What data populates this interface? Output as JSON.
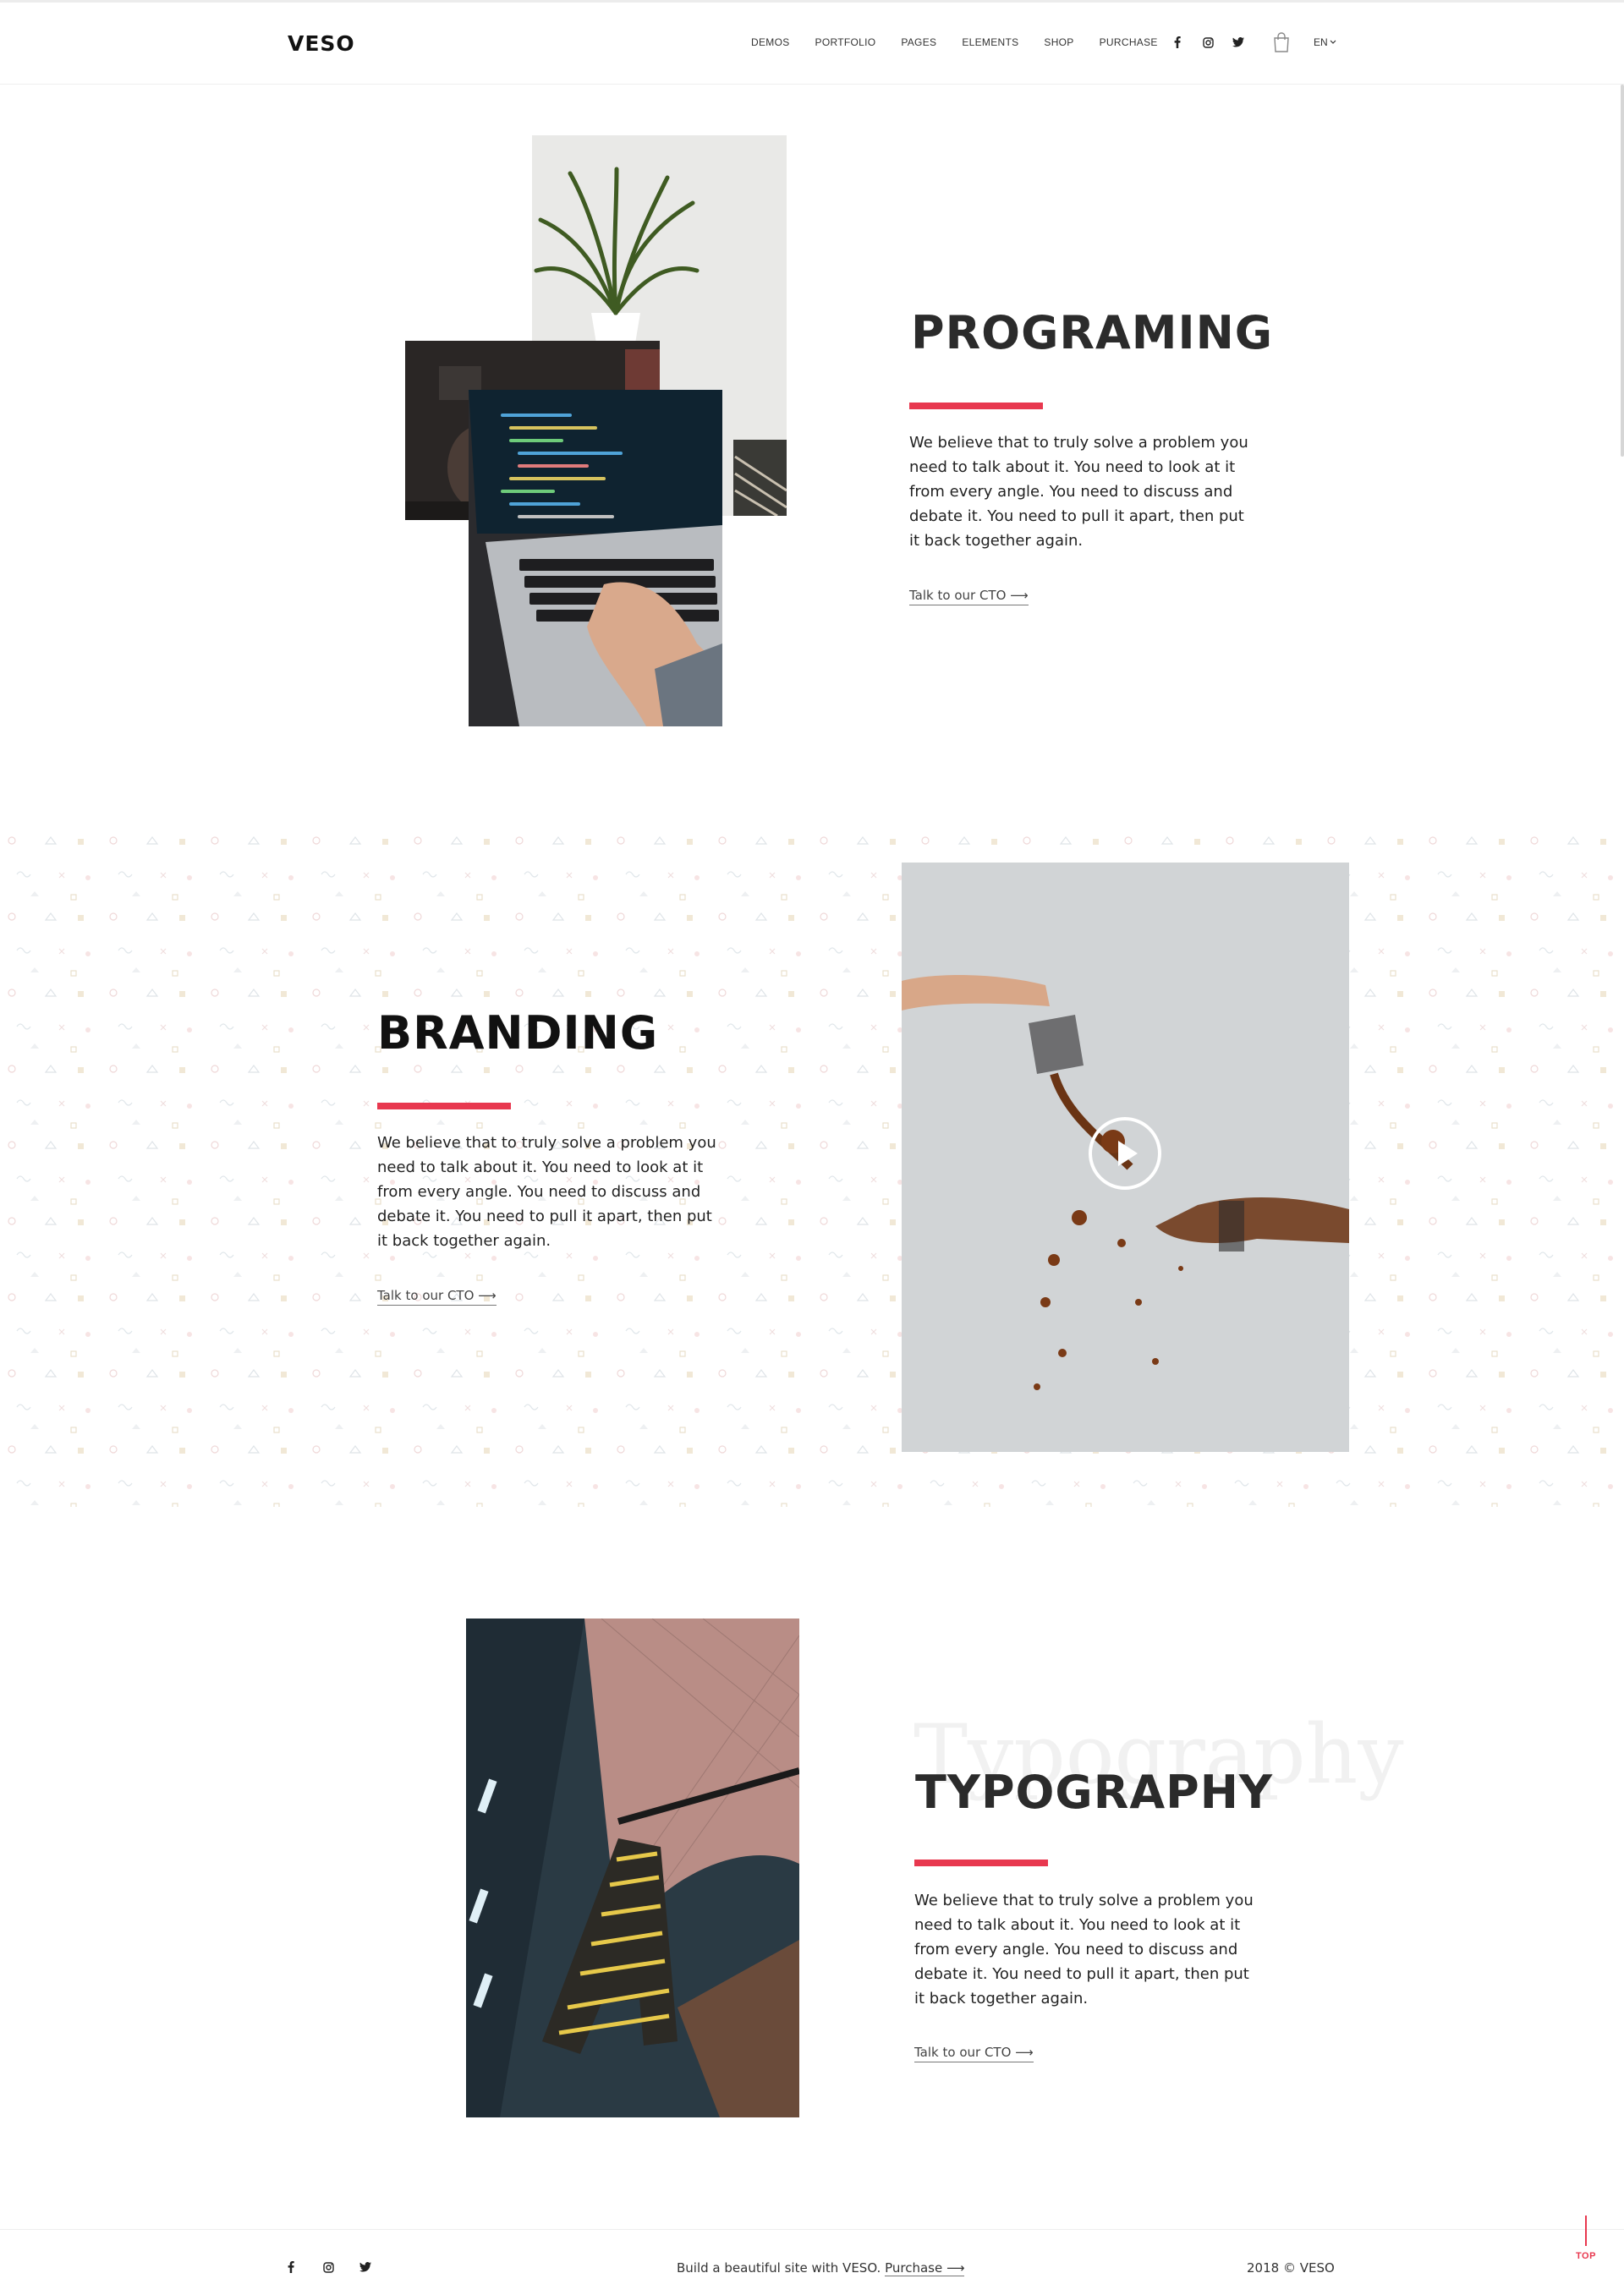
{
  "brand": {
    "logo": "VESO",
    "accent": "#e8384f"
  },
  "nav": {
    "items": [
      "DEMOS",
      "PORTFOLIO",
      "PAGES",
      "ELEMENTS",
      "SHOP",
      "PURCHASE"
    ],
    "social_icons": [
      "facebook-icon",
      "instagram-icon",
      "twitter-icon"
    ],
    "cart_icon": "shopping-bag-icon",
    "language": "EN"
  },
  "sections": [
    {
      "id": "programming",
      "heading": "PROGRAMING",
      "text": "We believe that to truly solve a problem you need to talk about it. You need to look at it from every angle. You need to discuss and debate it. You need to pull it apart, then put it back together again.",
      "cta": "Talk to our CTO ⟶"
    },
    {
      "id": "branding",
      "heading": "BRANDING",
      "text": "We believe that to truly solve a problem you need to talk about it. You need to look at it from every angle. You need to discuss and debate it. You need to pull it apart, then put it back together again.",
      "cta": "Talk to our CTO ⟶",
      "video_icon": "play-icon"
    },
    {
      "id": "typography",
      "heading": "TYPOGRAPHY",
      "watermark": "Typography",
      "text": "We believe that to truly solve a problem you need to talk about it. You need to look at it from every angle. You need to discuss and debate it. You need to pull it apart, then put it back together again.",
      "cta": "Talk to our CTO ⟶"
    }
  ],
  "footer": {
    "tagline": "Build a beautiful site with VESO.",
    "purchase_link": "Purchase ⟶",
    "copyright": "2018 © VESO",
    "social_icons": [
      "facebook-icon",
      "instagram-icon",
      "twitter-icon"
    ]
  },
  "back_to_top": "TOP"
}
